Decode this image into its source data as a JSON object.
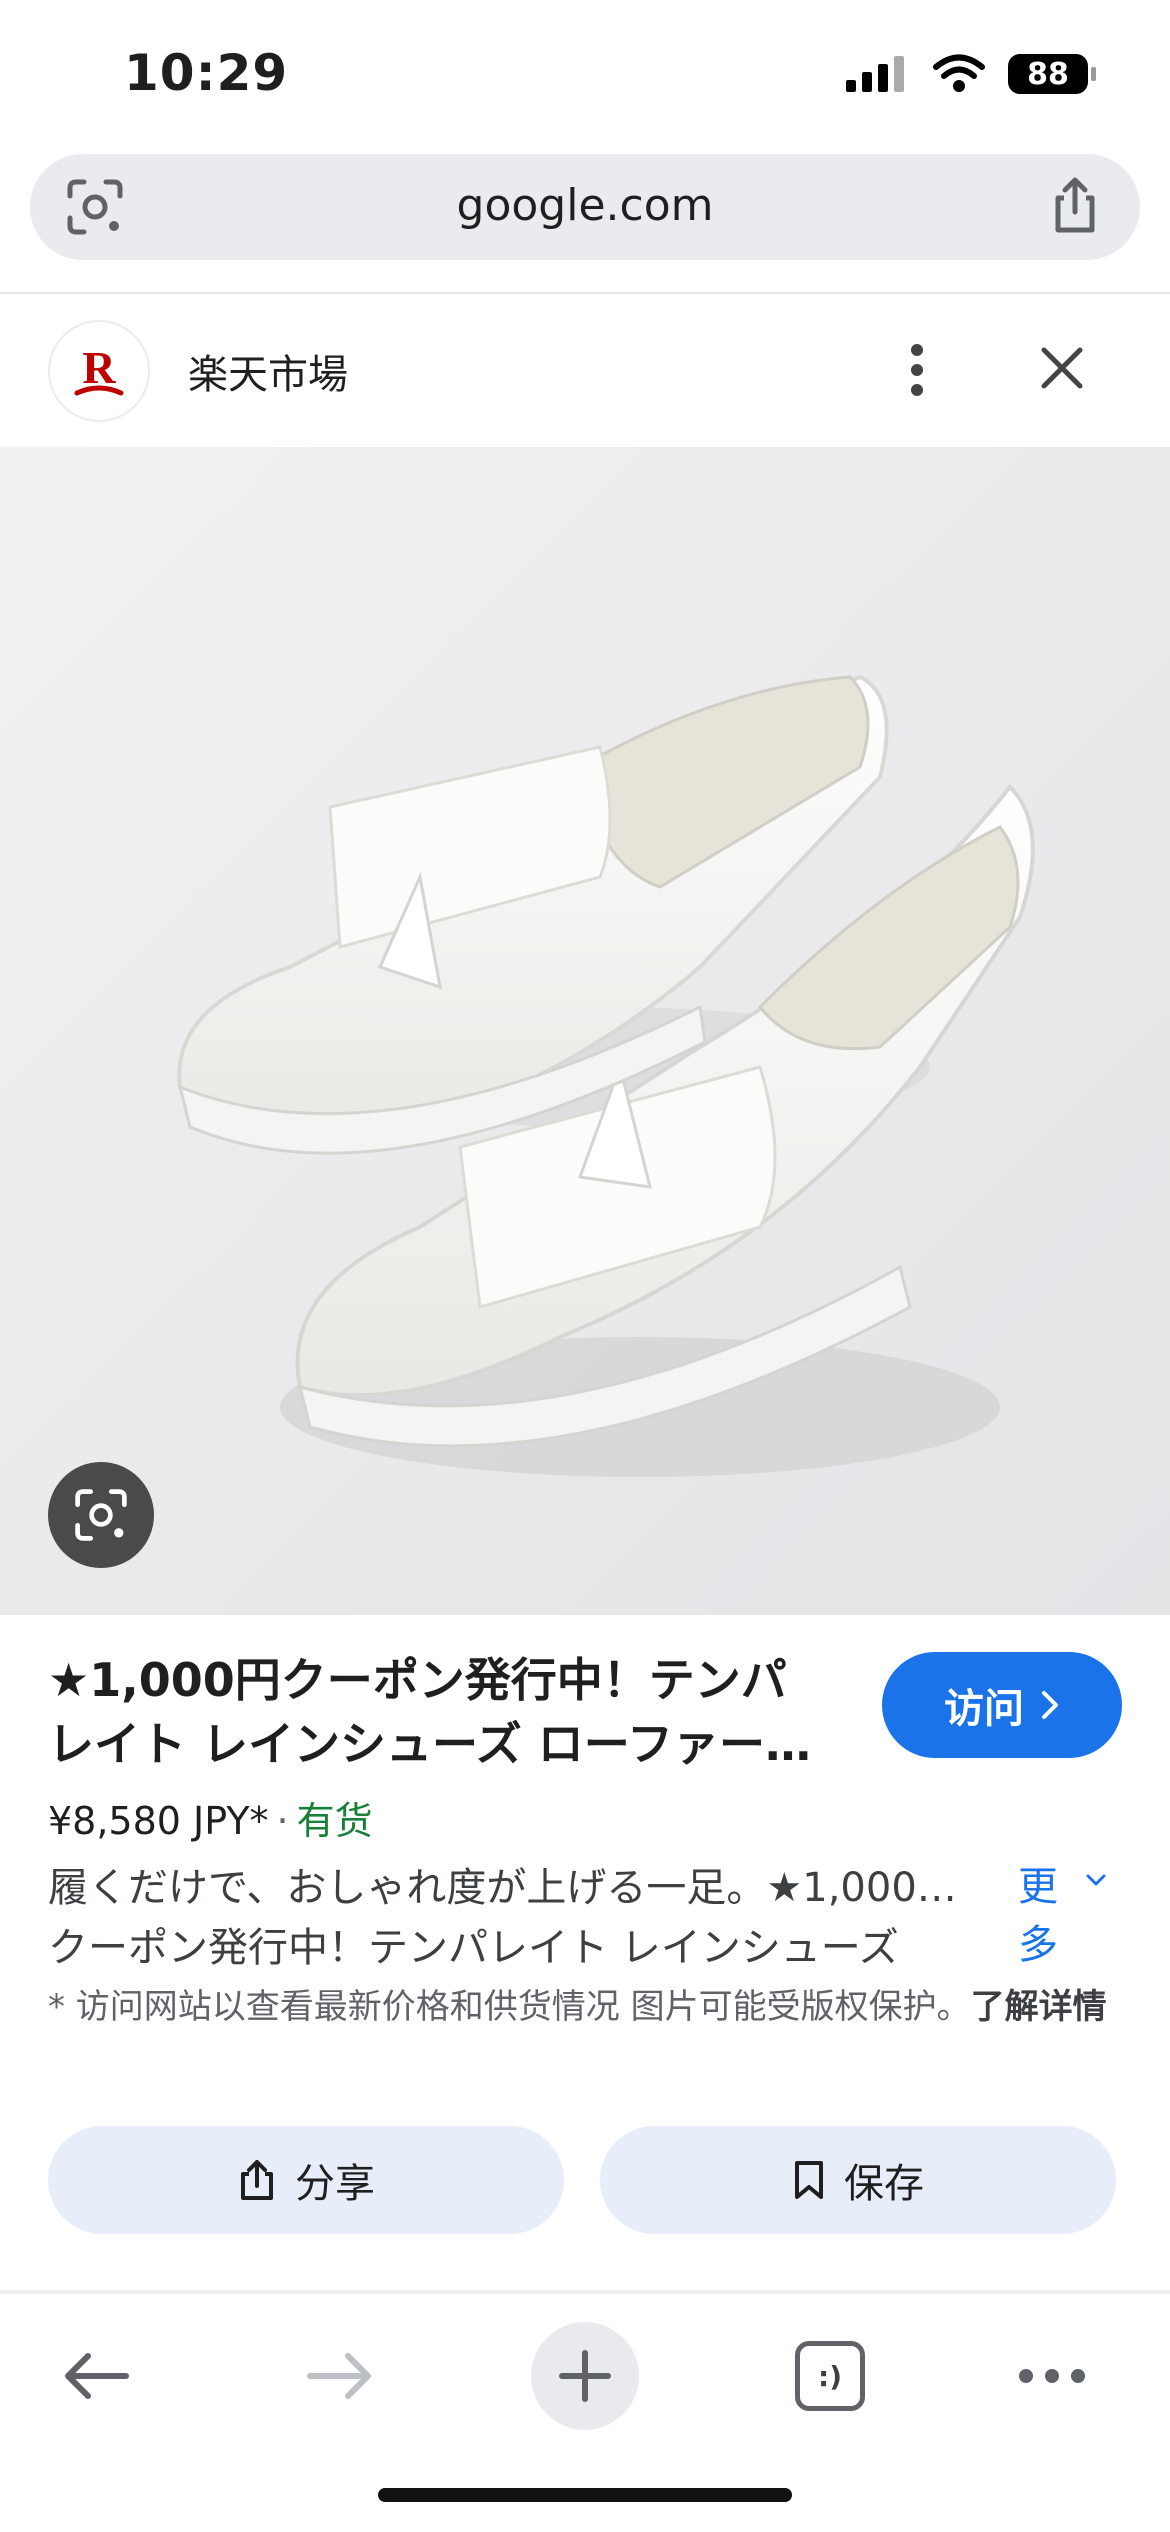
{
  "status_bar": {
    "time": "10:29",
    "battery": "88"
  },
  "browser": {
    "url": "google.com"
  },
  "source": {
    "name": "楽天市場",
    "logo_letter": "R"
  },
  "product": {
    "title_line1": "★1,000円クーポン発行中！テンパ",
    "title_line2": "レイト レインシューズ ローファー…",
    "price": "¥8,580 JPY*",
    "separator": "·",
    "stock": "有货",
    "description_line1": "履くだけで、おしゃれ度が上げる一足。★1,000…",
    "description_line2": "クーポン発行中！テンパレイト レインシューズ",
    "more_label_1": "更",
    "more_label_2": "多",
    "note": "* 访问网站以查看最新价格和供货情况 图片可能受版权保护。",
    "note_link": "了解详情"
  },
  "actions": {
    "visit": "访问",
    "share": "分享",
    "save": "保存"
  },
  "toolbar": {
    "tabs_label": ":)"
  },
  "colors": {
    "accent": "#1a73e8",
    "stock_green": "#188038",
    "rakuten_red": "#bf0000"
  }
}
